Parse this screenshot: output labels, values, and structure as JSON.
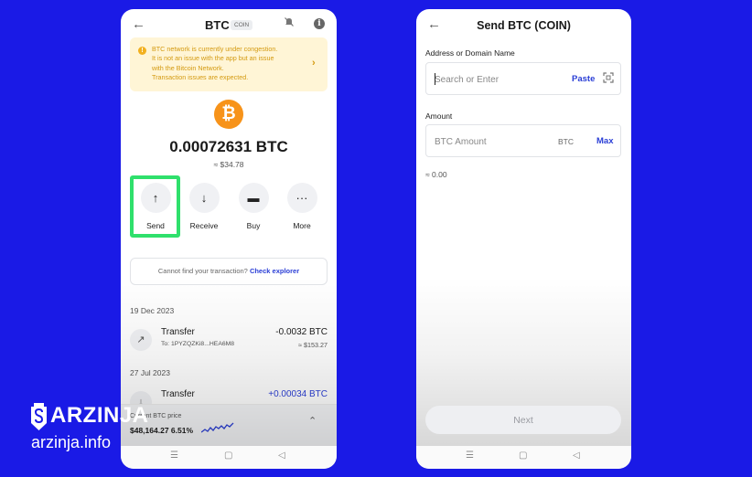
{
  "left_screen": {
    "header": {
      "title": "BTC",
      "badge": "COIN",
      "back_icon": "arrow-left-icon",
      "mute_icon": "bell-off-icon",
      "info_icon": "info-icon"
    },
    "warning": {
      "lines": [
        "BTC network is currently under congestion.",
        "It is not an issue with the app but an issue",
        "with the Bitcoin Network.",
        "Transaction issues are expected."
      ],
      "accent": "#d49a10",
      "background": "#fff5d6"
    },
    "coin_symbol": "₿",
    "balance": "0.00072631 BTC",
    "fiat": "≈ $34.78",
    "actions": [
      {
        "label": "Send",
        "icon": "↑"
      },
      {
        "label": "Receive",
        "icon": "↓"
      },
      {
        "label": "Buy",
        "icon": "▬"
      },
      {
        "label": "More",
        "icon": "···"
      }
    ],
    "highlight_color": "#2fe06c",
    "explorer_text": "Cannot find your transaction?",
    "explorer_link": "Check explorer",
    "transactions": [
      {
        "date": "19 Dec 2023",
        "type": "Transfer",
        "to": "To: 1PYZQZKi8...HEA6M8",
        "amount": "-0.0032 BTC",
        "fiat": "≈ $153.27",
        "icon": "↗"
      },
      {
        "date": "27 Jul 2023",
        "type": "Transfer",
        "to": "",
        "amount": "+0.00034 BTC",
        "fiat": "",
        "icon": "↓"
      }
    ],
    "price_bar": {
      "label": "Current BTC price",
      "value": "$48,164.27 6.51%",
      "chevron": "⌃"
    }
  },
  "right_screen": {
    "header": {
      "title": "Send BTC (COIN)",
      "back_icon": "arrow-left-icon"
    },
    "address": {
      "label": "Address or Domain Name",
      "placeholder": "Search or Enter",
      "paste": "Paste",
      "scan_icon": "scan-icon"
    },
    "amount": {
      "label": "Amount",
      "placeholder": "BTC Amount",
      "unit": "BTC",
      "max": "Max"
    },
    "approx": "≈ 0.00",
    "next": "Next"
  },
  "system_nav": {
    "menu": "☰",
    "home": "▢",
    "back": "◁"
  },
  "watermark": {
    "brand": "ARZINJA",
    "site": "arzinja.info"
  },
  "colors": {
    "background": "#1a1ae6",
    "link": "#2a3ed6",
    "btc_orange": "#f7931a"
  }
}
